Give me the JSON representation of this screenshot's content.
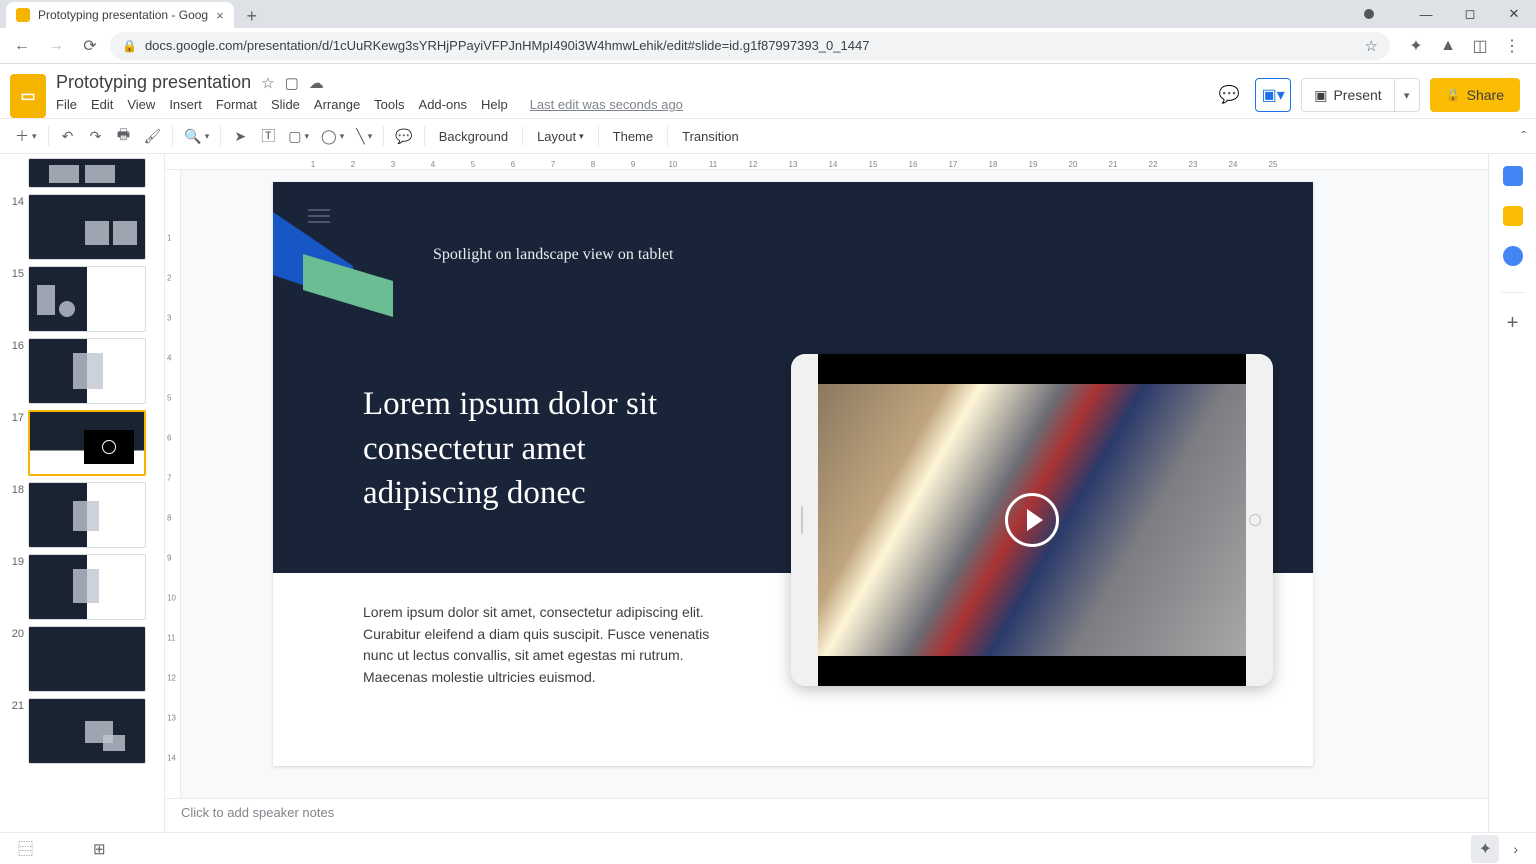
{
  "browser": {
    "tab_title": "Prototyping presentation - Goog",
    "url": "docs.google.com/presentation/d/1cUuRKewg3sYRHjPPayiVFPJnHMpI490i3W4hmwLehik/edit#slide=id.g1f87997393_0_1447"
  },
  "doc": {
    "title": "Prototyping presentation",
    "edit_status": "Last edit was seconds ago"
  },
  "menus": {
    "file": "File",
    "edit": "Edit",
    "view": "View",
    "insert": "Insert",
    "format": "Format",
    "slide": "Slide",
    "arrange": "Arrange",
    "tools": "Tools",
    "addons": "Add-ons",
    "help": "Help"
  },
  "header_buttons": {
    "present": "Present",
    "share": "Share"
  },
  "toolbar": {
    "background": "Background",
    "layout": "Layout",
    "theme": "Theme",
    "transition": "Transition"
  },
  "thumbnails": [
    {
      "num": "14"
    },
    {
      "num": "15"
    },
    {
      "num": "16"
    },
    {
      "num": "17",
      "active": true
    },
    {
      "num": "18"
    },
    {
      "num": "19"
    },
    {
      "num": "20"
    },
    {
      "num": "21"
    }
  ],
  "slide": {
    "subtitle": "Spotlight on landscape view on tablet",
    "heading_l1": "Lorem ipsum dolor sit",
    "heading_l2": "consectetur amet",
    "heading_l3": "adipiscing donec",
    "body": "Lorem ipsum dolor sit amet, consectetur adipiscing elit. Curabitur eleifend a diam quis suscipit. Fusce venenatis nunc ut lectus convallis, sit amet egestas mi rutrum. Maecenas molestie ultricies euismod."
  },
  "ruler_h": [
    "1",
    "2",
    "3",
    "4",
    "5",
    "6",
    "7",
    "8",
    "9",
    "10",
    "11",
    "12",
    "13",
    "14",
    "15",
    "16",
    "17",
    "18",
    "19",
    "20",
    "21",
    "22",
    "23",
    "24",
    "25"
  ],
  "ruler_v": [
    "1",
    "2",
    "3",
    "4",
    "5",
    "6",
    "7",
    "8",
    "9",
    "10",
    "11",
    "12",
    "13",
    "14"
  ],
  "notes": {
    "placeholder": "Click to add speaker notes"
  }
}
